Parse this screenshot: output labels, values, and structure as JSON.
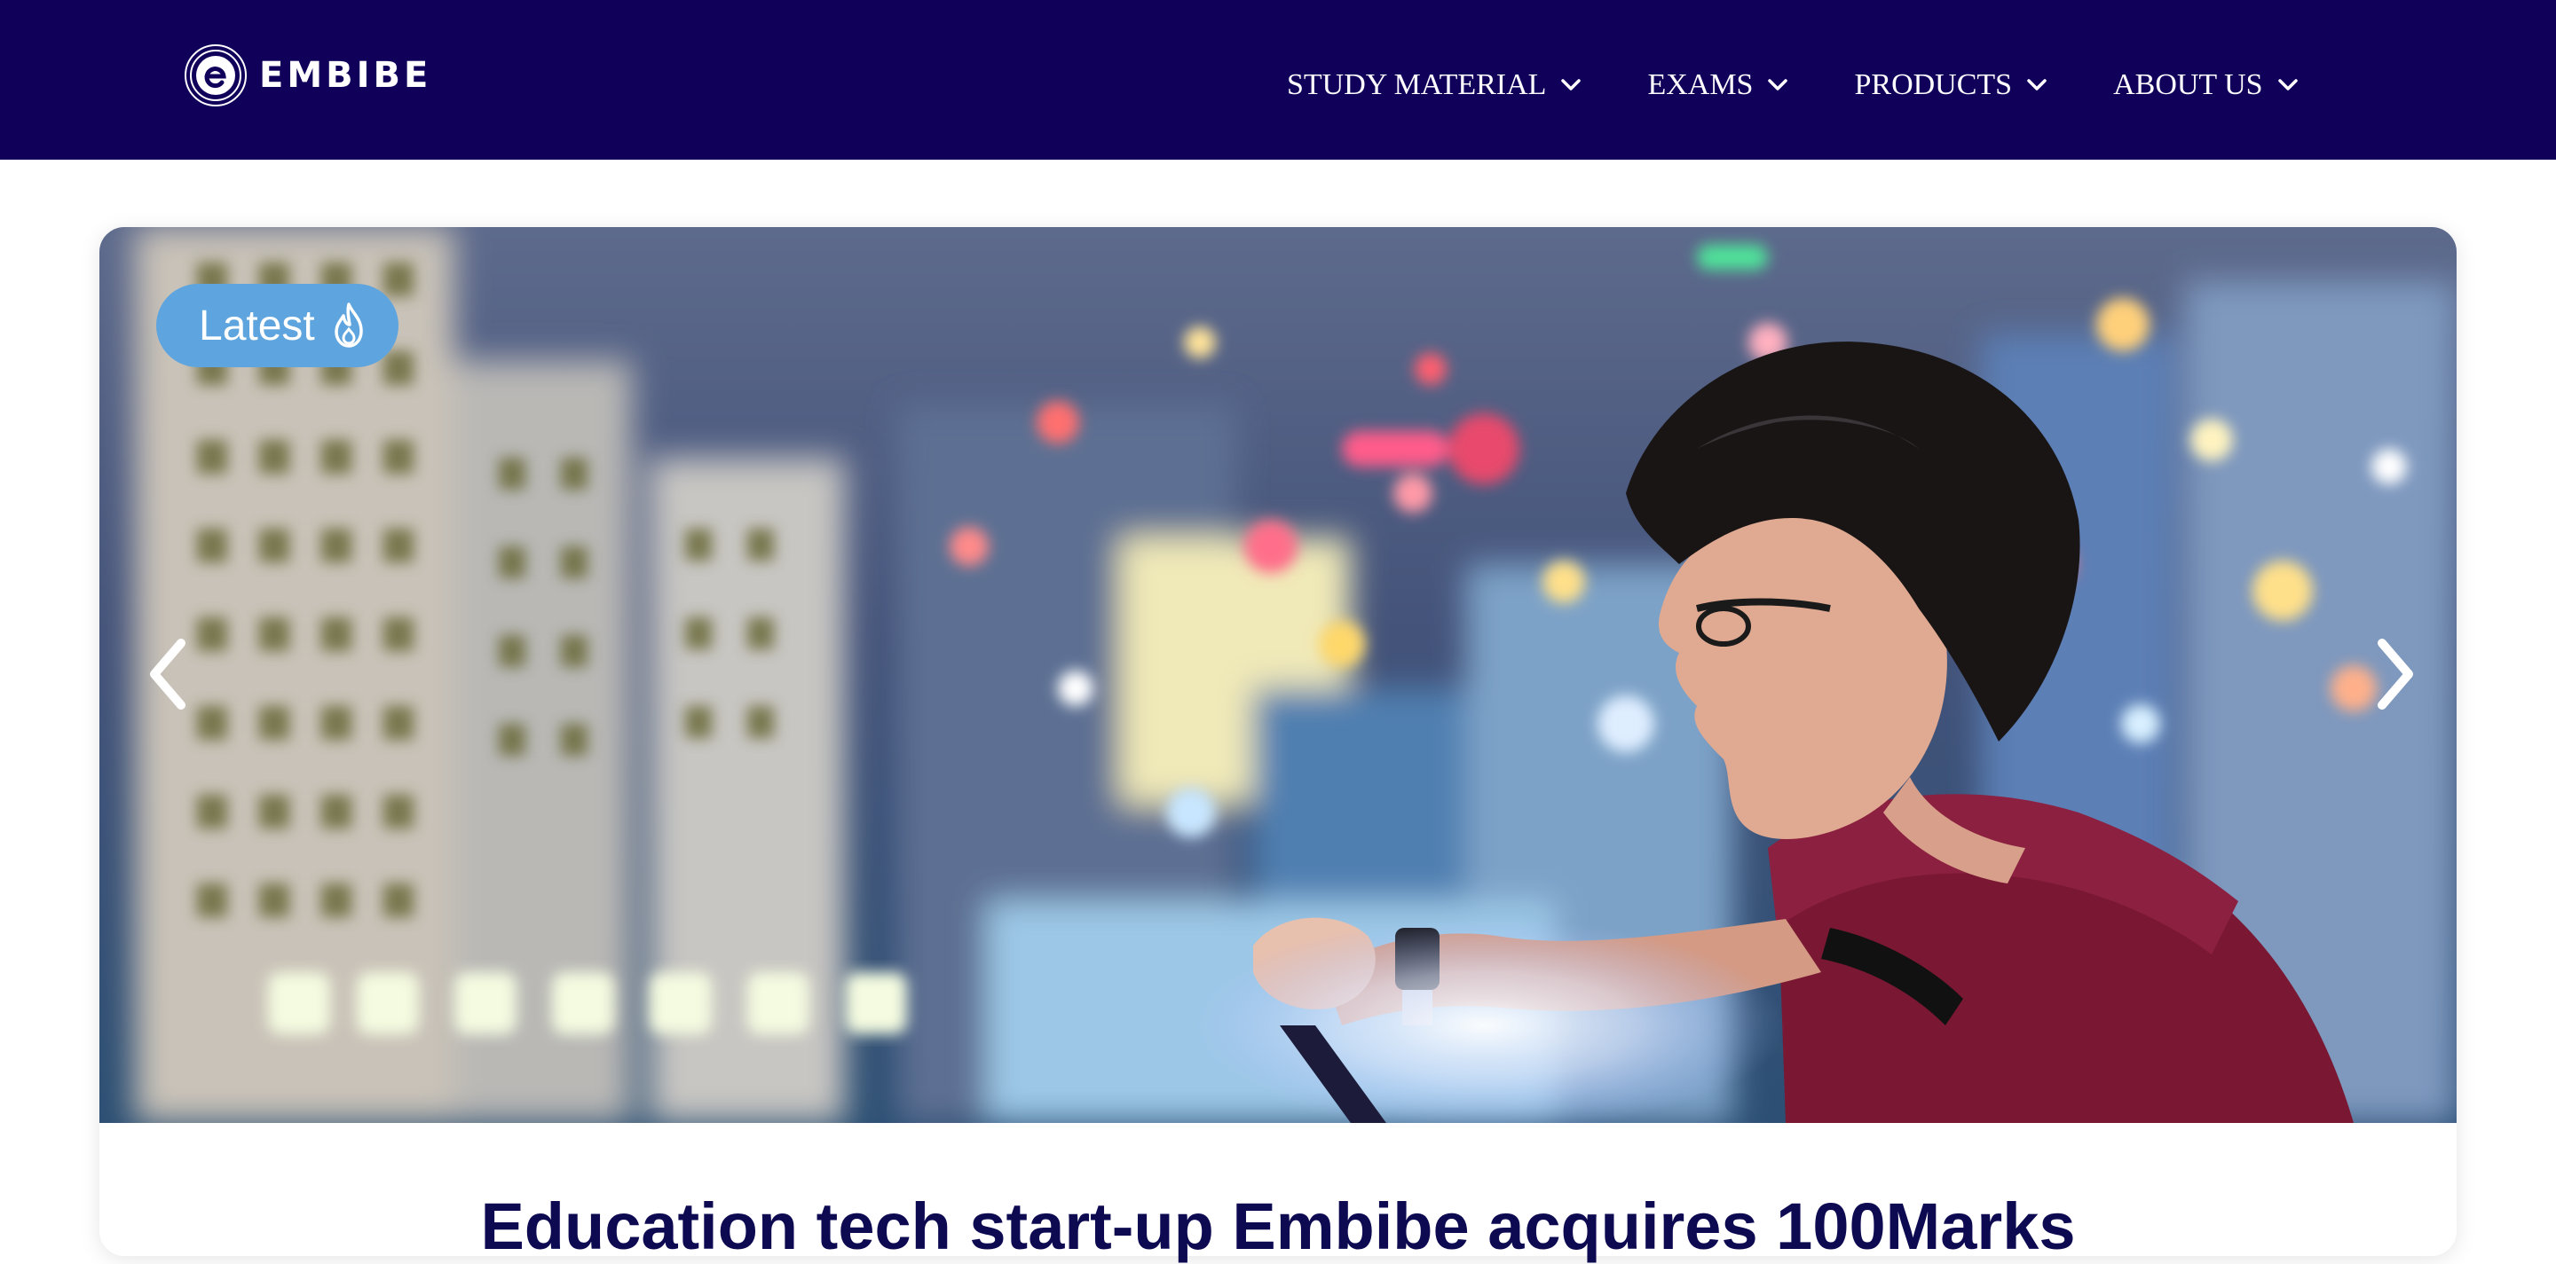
{
  "brand": {
    "name": "EMBIBE",
    "logo_icon": "embibe-spiral-logo-icon",
    "header_bg": "#10005a"
  },
  "nav": {
    "items": [
      {
        "label": "STUDY MATERIAL",
        "icon": "chevron-down-icon"
      },
      {
        "label": "EXAMS",
        "icon": "chevron-down-icon"
      },
      {
        "label": "PRODUCTS",
        "icon": "chevron-down-icon"
      },
      {
        "label": "ABOUT US",
        "icon": "chevron-down-icon"
      }
    ]
  },
  "carousel": {
    "badge": {
      "label": "Latest",
      "icon": "fire-icon",
      "color": "#5ea4de"
    },
    "prev_icon": "chevron-left-icon",
    "next_icon": "chevron-right-icon",
    "image": "person-with-tablet-city-night-bokeh"
  },
  "article": {
    "title": "Education tech start-up Embibe acquires 100Marks",
    "title_color": "#0d0a52"
  }
}
